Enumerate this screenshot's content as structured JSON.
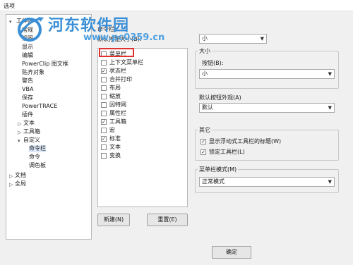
{
  "window": {
    "title": "选项"
  },
  "watermark": {
    "name": "河东软件园",
    "url": "www.pc0359.cn"
  },
  "tree": {
    "items": [
      {
        "label": "工作区"
      },
      {
        "label": "常规"
      },
      {
        "label": "视图"
      },
      {
        "label": "显示"
      },
      {
        "label": "编辑"
      },
      {
        "label": "PowerClip 图文框"
      },
      {
        "label": "贴齐对象"
      },
      {
        "label": "警告"
      },
      {
        "label": "VBA"
      },
      {
        "label": "保存"
      },
      {
        "label": "PowerTRACE"
      },
      {
        "label": "插件"
      },
      {
        "label": "文本"
      },
      {
        "label": "工具箱"
      },
      {
        "label": "自定义"
      },
      {
        "label": "命令栏"
      },
      {
        "label": "命令"
      },
      {
        "label": "调色板"
      },
      {
        "label": "文档"
      },
      {
        "label": "全局"
      }
    ]
  },
  "commandbars": {
    "title": "命令栏",
    "size_label": "默认按钮大小(B):",
    "items": [
      {
        "label": "菜单栏",
        "checked": false
      },
      {
        "label": "上下文菜单栏",
        "checked": false
      },
      {
        "label": "状态栏",
        "checked": true
      },
      {
        "label": "合并打印",
        "checked": false
      },
      {
        "label": "布局",
        "checked": false
      },
      {
        "label": "缩放",
        "checked": false
      },
      {
        "label": "因特网",
        "checked": false
      },
      {
        "label": "属性栏",
        "checked": false
      },
      {
        "label": "工具箱",
        "checked": true
      },
      {
        "label": "宏",
        "checked": false
      },
      {
        "label": "标准",
        "checked": true
      },
      {
        "label": "文本",
        "checked": false
      },
      {
        "label": "变换",
        "checked": false
      }
    ],
    "new_button": "新建(N)",
    "reset_button": "重置(E)"
  },
  "right": {
    "top_combo_value": "小",
    "size_group_title": "大小",
    "button_label": "按钮(B):",
    "button_value": "小",
    "appearance_label": "默认按钮外观(A)",
    "appearance_value": "默认",
    "other_group_title": "其它",
    "show_title_label": "显示浮动式工具栏的标题(W)",
    "show_title_checked": true,
    "lock_label": "锁定工具栏(L)",
    "lock_checked": true,
    "menubar_mode_label": "菜单栏模式(M)",
    "menubar_mode_value": "正常模式"
  },
  "footer": {
    "ok_button": "确定"
  },
  "check_glyph": "✓"
}
